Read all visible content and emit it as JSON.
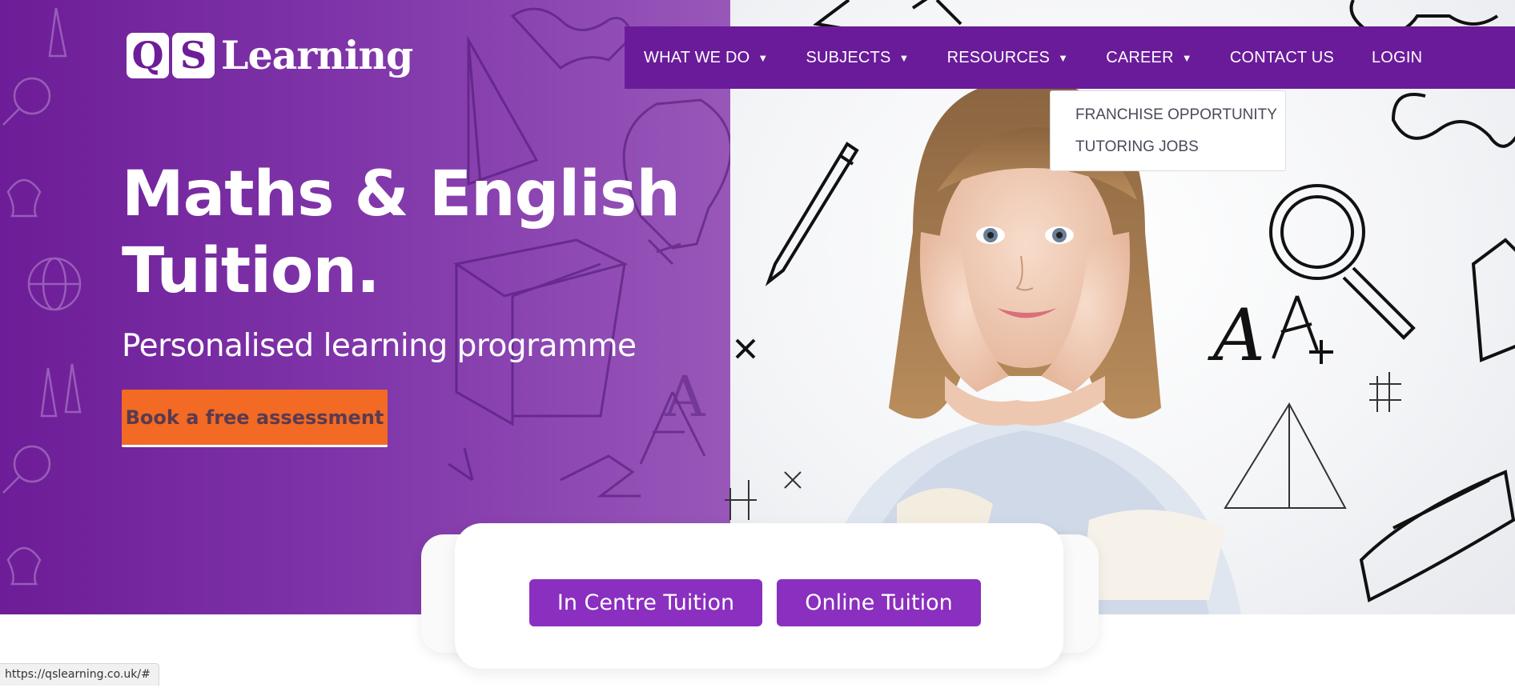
{
  "brand": {
    "logo_letter_1": "Q",
    "logo_letter_2": "S",
    "logo_word": "Learning"
  },
  "nav": {
    "items": [
      {
        "label": "WHAT WE DO",
        "caret": "▼"
      },
      {
        "label": "SUBJECTS",
        "caret": "▼"
      },
      {
        "label": "RESOURCES",
        "caret": "▼"
      },
      {
        "label": "CAREER",
        "caret": "▼"
      },
      {
        "label": "CONTACT US"
      },
      {
        "label": "LOGIN"
      }
    ],
    "career_dropdown": [
      "FRANCHISE OPPORTUNITY",
      "TUTORING JOBS"
    ]
  },
  "hero": {
    "headline_line1": "Maths & English",
    "headline_line2": "Tuition.",
    "subheadline": "Personalised learning programme",
    "cta_label": "Book a free assessment"
  },
  "tuition": {
    "in_centre_label": "In Centre Tuition",
    "online_label": "Online Tuition"
  },
  "status_url": "https://qslearning.co.uk/#",
  "colors": {
    "brand_purple": "#6a1b9a",
    "accent_orange": "#f26a24",
    "button_purple": "#8a2fbf"
  }
}
